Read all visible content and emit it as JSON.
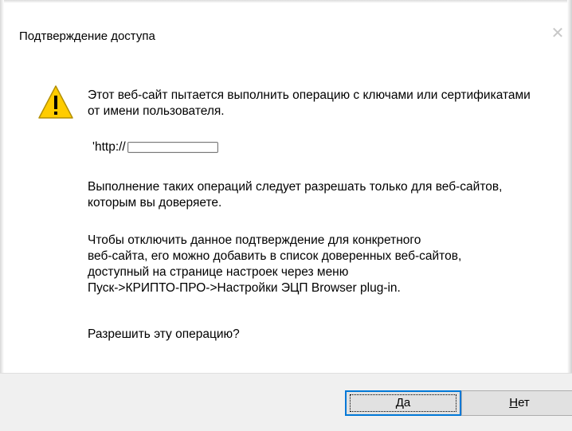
{
  "dialog": {
    "title": "Подтверждение доступа",
    "close_symbol": "✕",
    "message_1": "Этот веб-сайт пытается выполнить операцию с ключами или сертификатами от имени пользователя.",
    "url_prefix": "'http://",
    "message_2": "Выполнение таких операций следует разрешать только для веб-сайтов, которым вы доверяете.",
    "message_3_lines": [
      "Чтобы отключить данное подтверждение для конкретного",
      "веб-сайта, его можно добавить в список доверенных веб-сайтов,",
      "доступный на странице настроек через меню",
      "Пуск->КРИПТО-ПРО->Настройки ЭЦП Browser plug-in."
    ],
    "question": "Разрешить эту операцию?"
  },
  "buttons": {
    "yes_mnemonic": "Д",
    "yes_rest": "а",
    "no_mnemonic": "Н",
    "no_rest": "ет"
  },
  "icon": {
    "name": "warning-icon",
    "fill_color": "#ffcc00",
    "stroke_color": "#b38f00"
  },
  "colors": {
    "focus_border": "#0078d7",
    "footer_bg": "#f0f0f0",
    "button_bg": "#e1e1e1"
  }
}
